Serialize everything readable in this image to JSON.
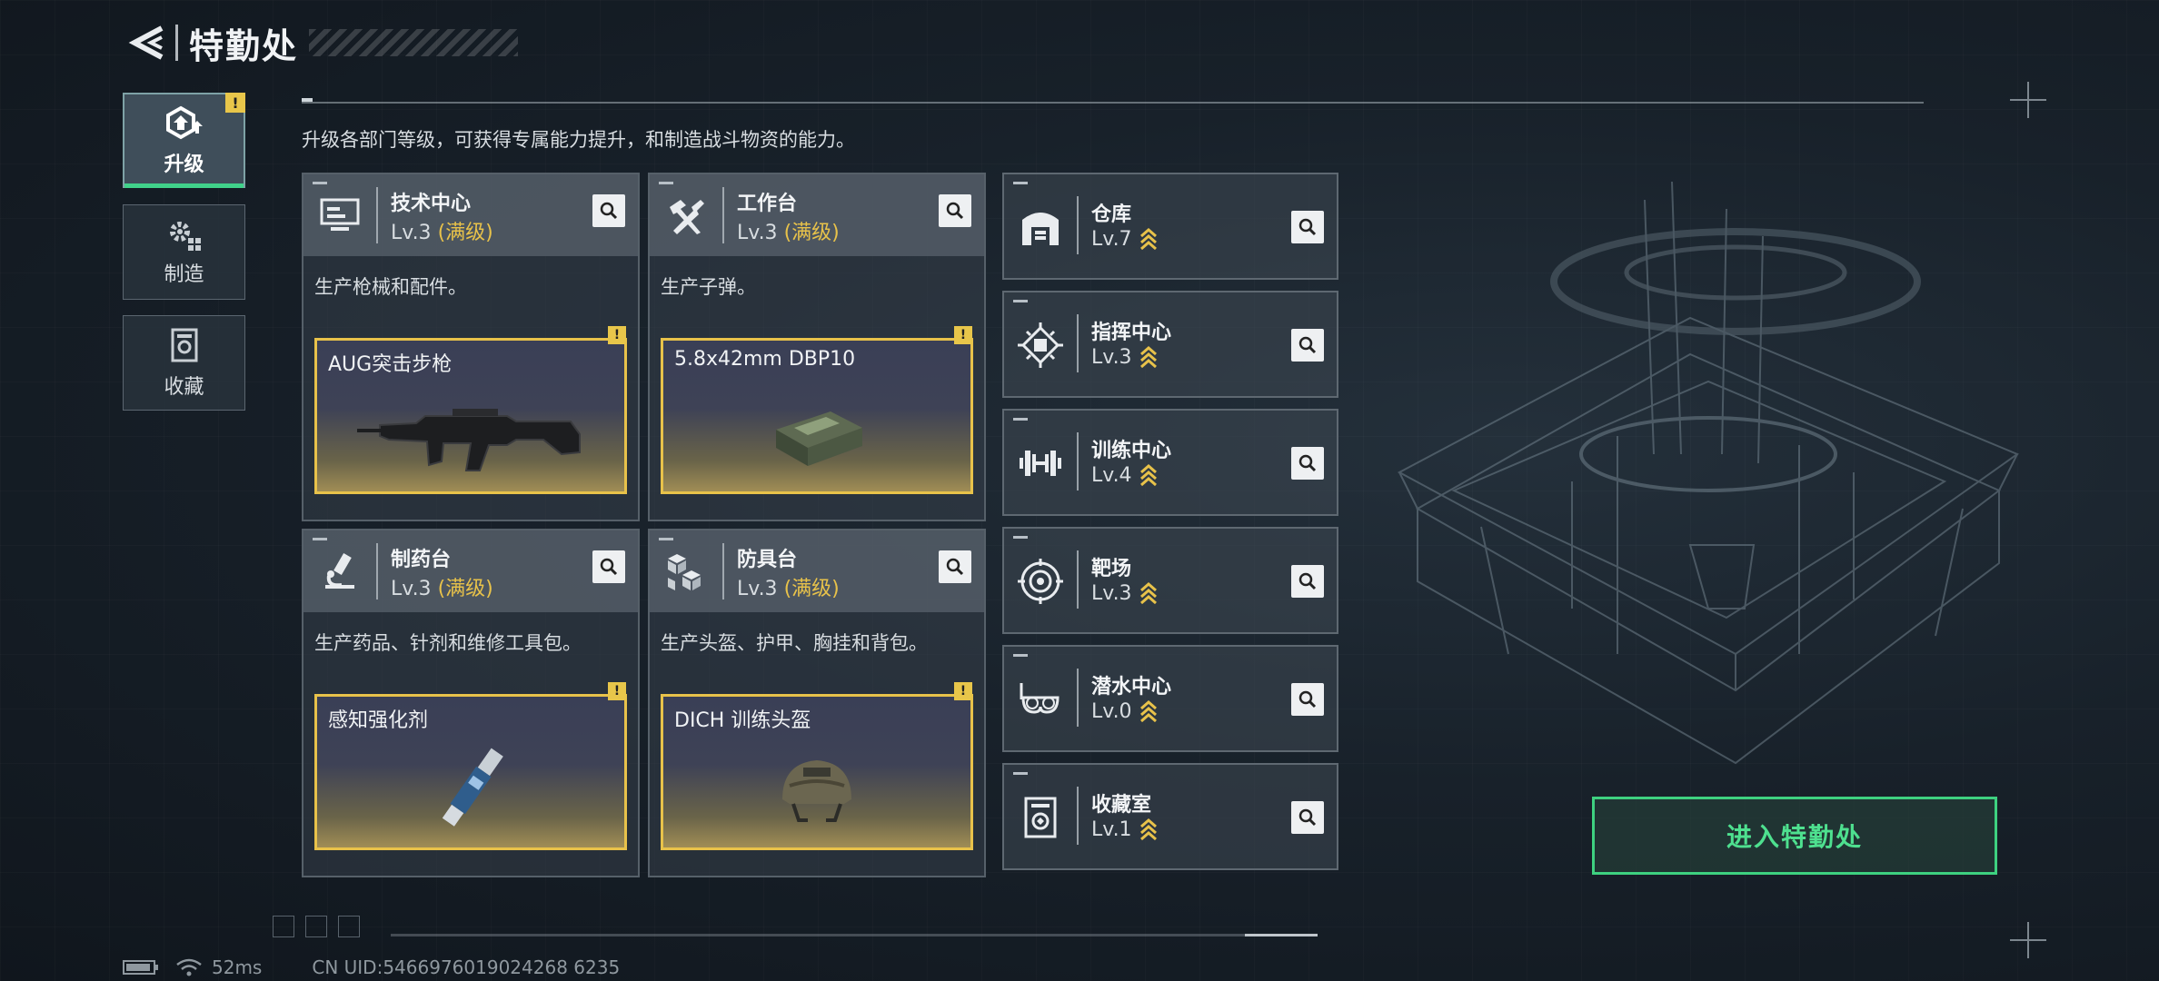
{
  "header": {
    "title": "特勤处"
  },
  "sidebar": {
    "tabs": [
      {
        "label": "升级",
        "icon": "upgrade-icon",
        "active": true,
        "alert": "!"
      },
      {
        "label": "制造",
        "icon": "gears-icon",
        "active": false
      },
      {
        "label": "收藏",
        "icon": "collection-icon",
        "active": false
      }
    ]
  },
  "description": "升级各部门等级，可获得专属能力提升，和制造战斗物资的能力。",
  "workstations": [
    {
      "name": "技术中心",
      "level": "Lv.3",
      "max_label": "(满级)",
      "desc": "生产枪械和配件。",
      "product": "AUG突击步枪",
      "alert": "!",
      "icon": "monitor-icon"
    },
    {
      "name": "工作台",
      "level": "Lv.3",
      "max_label": "(满级)",
      "desc": "生产子弹。",
      "product": "5.8x42mm DBP10",
      "alert": "!",
      "icon": "tools-icon"
    },
    {
      "name": "制药台",
      "level": "Lv.3",
      "max_label": "(满级)",
      "desc": "生产药品、针剂和维修工具包。",
      "product": "感知强化剂",
      "alert": "!",
      "icon": "microscope-icon"
    },
    {
      "name": "防具台",
      "level": "Lv.3",
      "max_label": "(满级)",
      "desc": "生产头盔、护甲、胸挂和背包。",
      "product": "DICH 训练头盔",
      "alert": "!",
      "icon": "cubes-icon"
    }
  ],
  "facilities": [
    {
      "name": "仓库",
      "level": "Lv.7",
      "icon": "warehouse-icon"
    },
    {
      "name": "指挥中心",
      "level": "Lv.3",
      "icon": "chip-icon"
    },
    {
      "name": "训练中心",
      "level": "Lv.4",
      "icon": "dumbbell-icon"
    },
    {
      "name": "靶场",
      "level": "Lv.3",
      "icon": "target-icon"
    },
    {
      "name": "潜水中心",
      "level": "Lv.0",
      "icon": "diving-mask-icon"
    },
    {
      "name": "收藏室",
      "level": "Lv.1",
      "icon": "collection-room-icon"
    }
  ],
  "enter_button": "进入特勤处",
  "footer": {
    "ping": "52ms",
    "uid": "CN UID:5466976019024268 6235"
  },
  "colors": {
    "accent_green": "#40d28a",
    "gold": "#e8c24a",
    "alert": "#e8c64a"
  }
}
